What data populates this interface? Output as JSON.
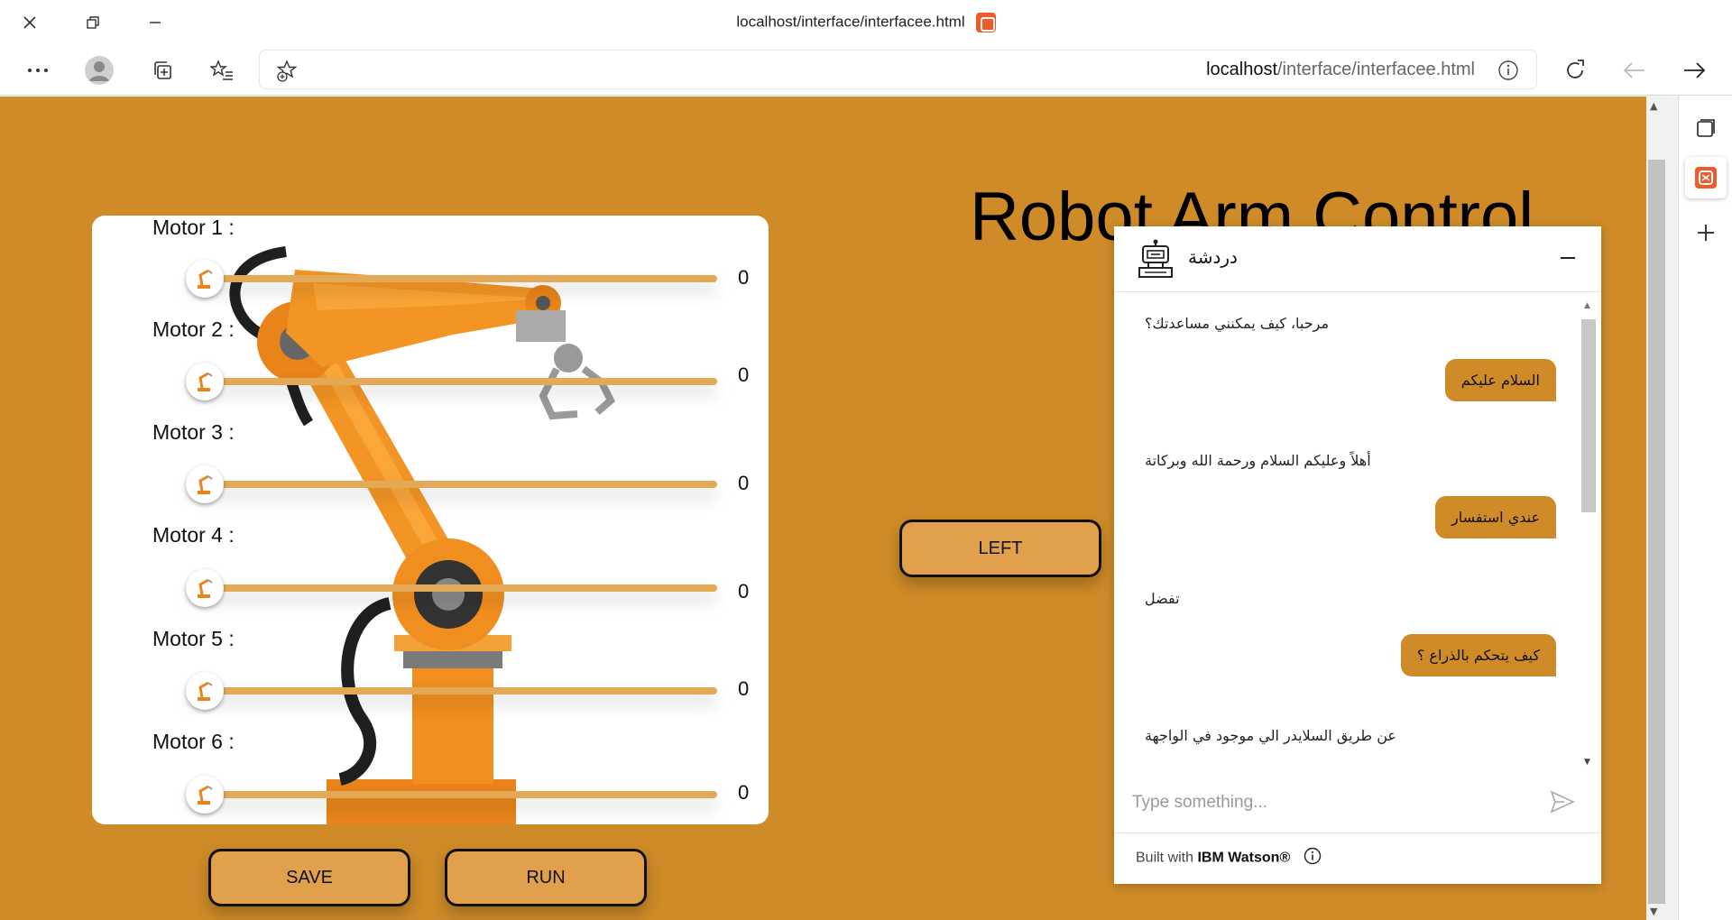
{
  "window": {
    "title": "localhost/interface/interfacee.html"
  },
  "address_bar": {
    "host": "localhost",
    "path": "/interface/interfacee.html"
  },
  "page": {
    "title": "Robot Arm Control",
    "motors": [
      {
        "label": "Motor 1 :",
        "value": "0"
      },
      {
        "label": "Motor 2 :",
        "value": "0"
      },
      {
        "label": "Motor 3 :",
        "value": "0"
      },
      {
        "label": "Motor 4 :",
        "value": "0"
      },
      {
        "label": "Motor 5 :",
        "value": "0"
      },
      {
        "label": "Motor 6 :",
        "value": "0"
      }
    ],
    "buttons": {
      "save": "SAVE",
      "run": "RUN",
      "left": "LEFT"
    }
  },
  "chat": {
    "title": "دردشة",
    "messages": [
      {
        "from": "bot",
        "text": "مرحبا، كيف يمكنني مساعدتك؟"
      },
      {
        "from": "user",
        "text": "السلام عليكم"
      },
      {
        "from": "bot",
        "text": "أهلاً وعليكم السلام ورحمة الله وبركاتة"
      },
      {
        "from": "user",
        "text": "عندي استفسار"
      },
      {
        "from": "bot",
        "text": "تفضل"
      },
      {
        "from": "user",
        "text": "كيف يتحكم بالذراع ؟"
      },
      {
        "from": "bot",
        "text": "عن طريق السلايدر الي موجود في الواجهة"
      }
    ],
    "input_placeholder": "Type something...",
    "footer_prefix": "Built with",
    "footer_brand": "IBM Watson®"
  },
  "colors": {
    "page_bg": "#cf8b28",
    "button_bg": "#e0a04c",
    "slider_track": "#e3a957",
    "user_bubble": "#cf8b28"
  }
}
